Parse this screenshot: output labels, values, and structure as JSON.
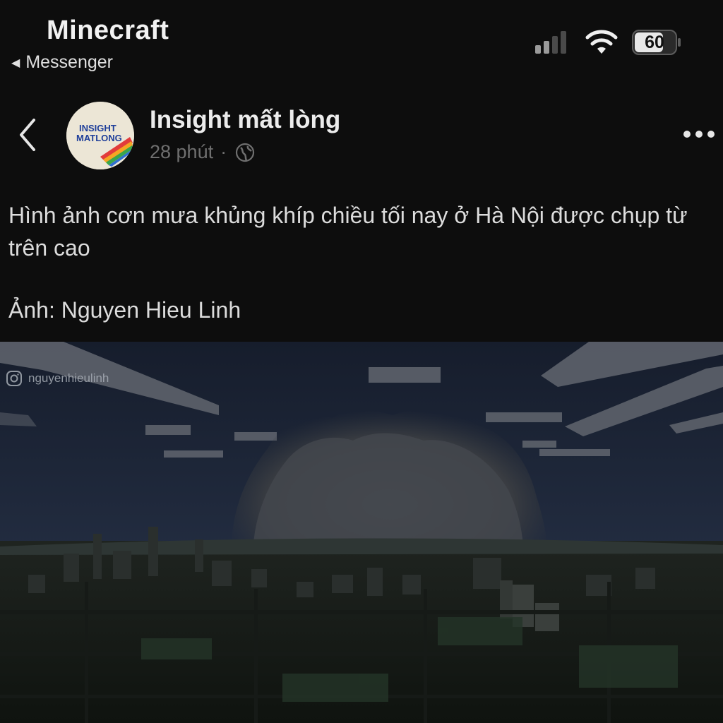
{
  "status_bar": {
    "app_title": "Minecraft",
    "back_label": "Messenger",
    "battery": "60",
    "icons": [
      "signal-icon",
      "wifi-icon",
      "battery-icon"
    ]
  },
  "post": {
    "page_name": "Insight mất lòng",
    "time": "28 phút",
    "separator": "·",
    "privacy_icon": "globe-icon",
    "avatar_text_line1": "INSIGHT",
    "avatar_text_line2": "MATLONG",
    "caption_line": "Hình ảnh cơn mưa khủng khíp chiều tối nay ở Hà Nội được chụp từ trên cao",
    "credit": "Ảnh: Nguyen Hieu Linh"
  },
  "photo": {
    "watermark": "nguyenhieulinh"
  },
  "colors": {
    "background": "#0d0d0d",
    "text": "#dcdcdc",
    "muted": "#6f6f6f",
    "sky": "#1c2436"
  }
}
